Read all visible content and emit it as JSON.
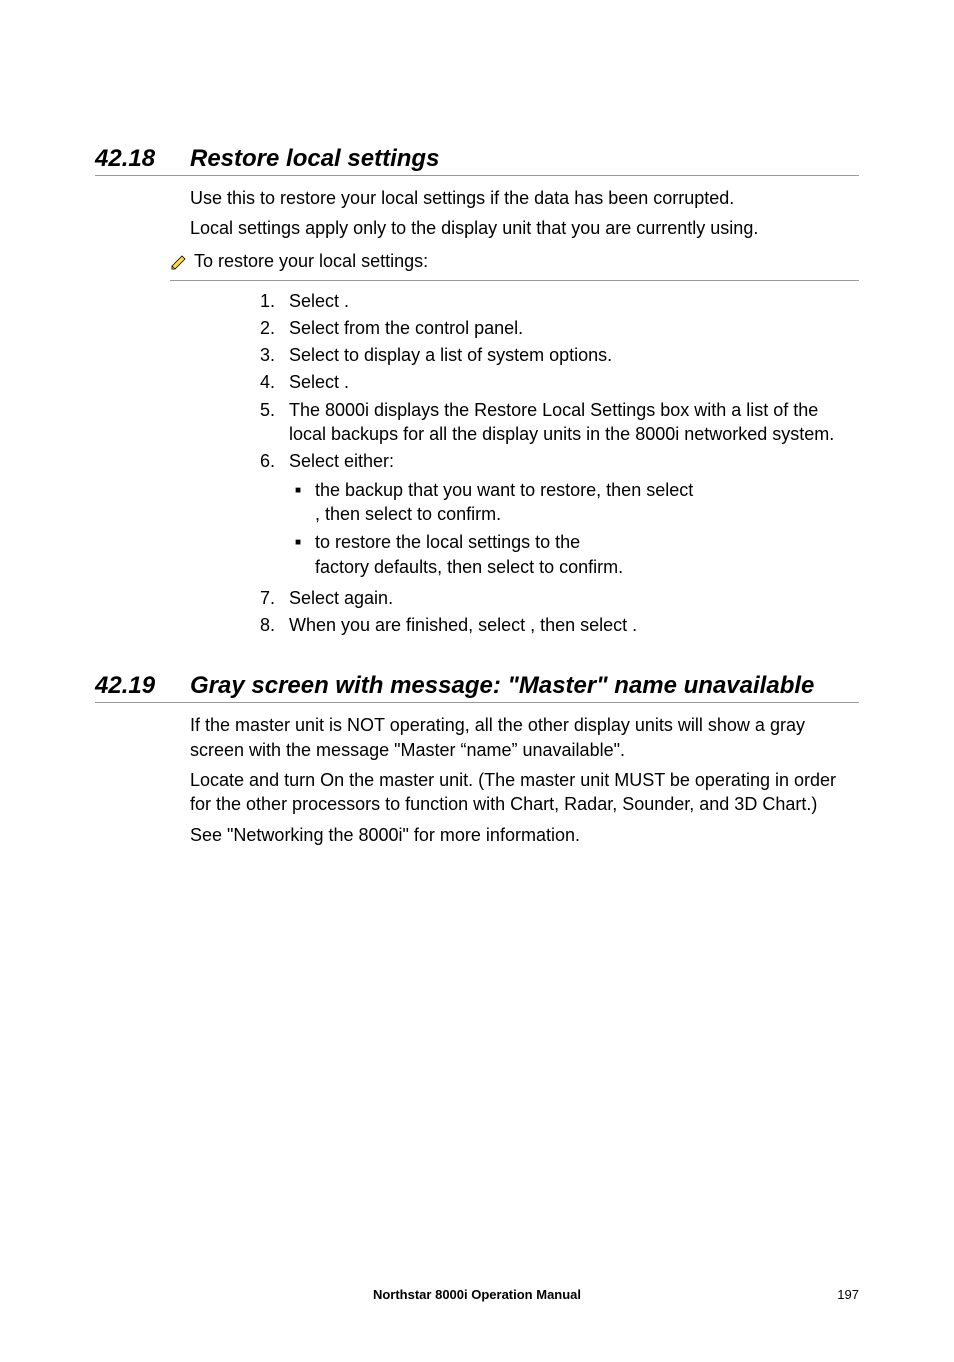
{
  "sections": [
    {
      "number": "42.18",
      "title": "Restore local settings",
      "intro": [
        "Use this to restore your local settings if the data has been corrupted.",
        "Local settings apply only to the display unit that you are currently using."
      ],
      "pencil": "To restore your local settings:",
      "steps": [
        {
          "n": "1.",
          "t": "Select               ."
        },
        {
          "n": "2.",
          "t": "Select                 from the control panel."
        },
        {
          "n": "3.",
          "t": "Select                          to display a list of system options."
        },
        {
          "n": "4.",
          "t": "Select                                                          ."
        },
        {
          "n": "5.",
          "t": "The 8000i displays the Restore Local Settings box with a list of the local backups for all the display units in the 8000i networked system."
        },
        {
          "n": "6.",
          "t": "Select either:",
          "sub": [
            {
              "line1": "the backup that you want to restore, then select",
              "line2": "                                                     , then select           to confirm."
            },
            {
              "line1": "                                                                     to restore the local settings to the",
              "line2": "factory defaults, then select           to confirm."
            }
          ]
        },
        {
          "n": "7.",
          "t": "Select           again."
        },
        {
          "n": "8.",
          "t": "When you are finished, select                  , then select                              ."
        }
      ]
    },
    {
      "number": "42.19",
      "title": "Gray screen with message:  \"Master\" name unavailable",
      "paragraphs": [
        "If the master unit is NOT operating, all the other display units will show a gray screen with the message  \"Master “name” unavailable\".",
        "Locate and turn On the master unit. (The master unit MUST be operating in order for the other processors to function with Chart, Radar, Sounder, and 3D Chart.)",
        "See \"Networking the 8000i\" for more information."
      ]
    }
  ],
  "footer": "Northstar 8000i Operation Manual",
  "pageNumber": "197"
}
